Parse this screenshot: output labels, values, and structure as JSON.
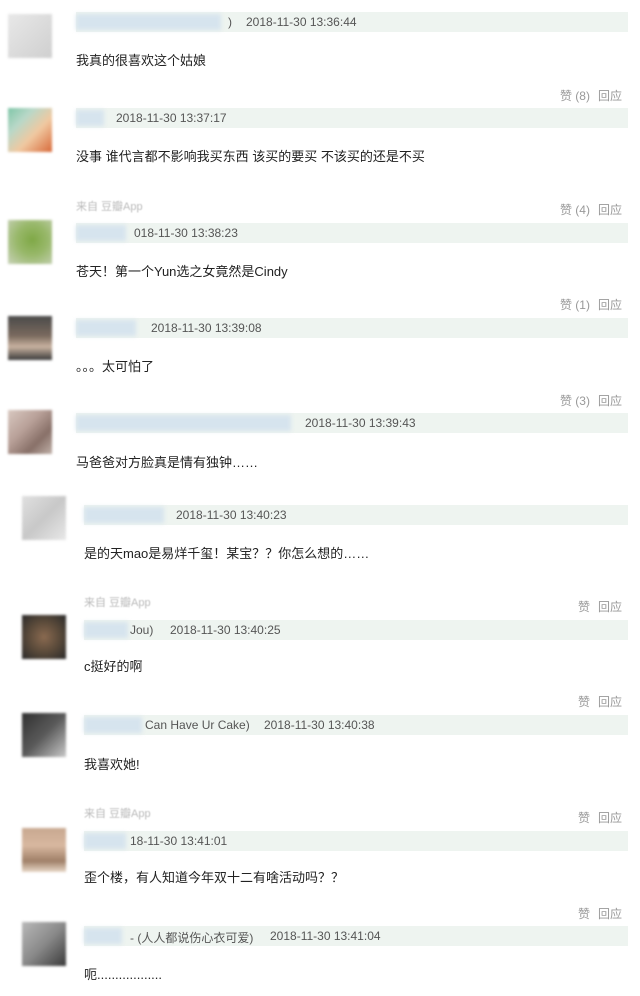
{
  "comments": [
    {
      "name_suffix": ")",
      "time": "2018-11-30 13:36:44",
      "text": "我真的很喜欢这个姑娘",
      "like": "赞 (8)",
      "reply": "回应"
    },
    {
      "name_suffix": "",
      "time": "2018-11-30 13:37:17",
      "text": "没事 谁代言都不影响我买东西 该买的要买 不该买的还是不买",
      "like": "赞 (4)",
      "reply": "回应",
      "source": "来自 豆瓣App"
    },
    {
      "name_suffix": "",
      "time": "018-11-30 13:38:23",
      "text": "苍天！第一个Yun选之女竟然是Cindy",
      "like": "赞 (1)",
      "reply": "回应"
    },
    {
      "name_suffix": "",
      "time": "2018-11-30 13:39:08",
      "text": "。。。太可怕了",
      "like": "赞 (3)",
      "reply": "回应"
    },
    {
      "name_suffix": "",
      "time": "2018-11-30 13:39:43",
      "text": "马爸爸对方脸真是情有独钟……"
    },
    {
      "name_suffix": "",
      "time": "2018-11-30 13:40:23",
      "text": "是的天mao是易烊千玺！某宝？？你怎么想的……",
      "like": "赞",
      "reply": "回应",
      "source": "来自 豆瓣App"
    },
    {
      "name_suffix": "Jou)",
      "time": "2018-11-30 13:40:25",
      "text": "c挺好的啊",
      "like": "赞",
      "reply": "回应"
    },
    {
      "name_suffix": "Can Have Ur Cake)",
      "time": "2018-11-30 13:40:38",
      "text": "我喜欢她!",
      "like": "赞",
      "reply": "回应",
      "source": "来自 豆瓣App"
    },
    {
      "name_suffix": "",
      "time": "18-11-30 13:41:01",
      "text": "歪个楼，有人知道今年双十二有啥活动吗？？",
      "like": "赞",
      "reply": "回应"
    },
    {
      "name_suffix": "- (人人都说伤心衣可爱)",
      "time": "2018-11-30 13:41:04",
      "text": "呃.................."
    }
  ],
  "colors": {
    "header_bg": "#eef4f0",
    "action_gray": "#999999"
  }
}
